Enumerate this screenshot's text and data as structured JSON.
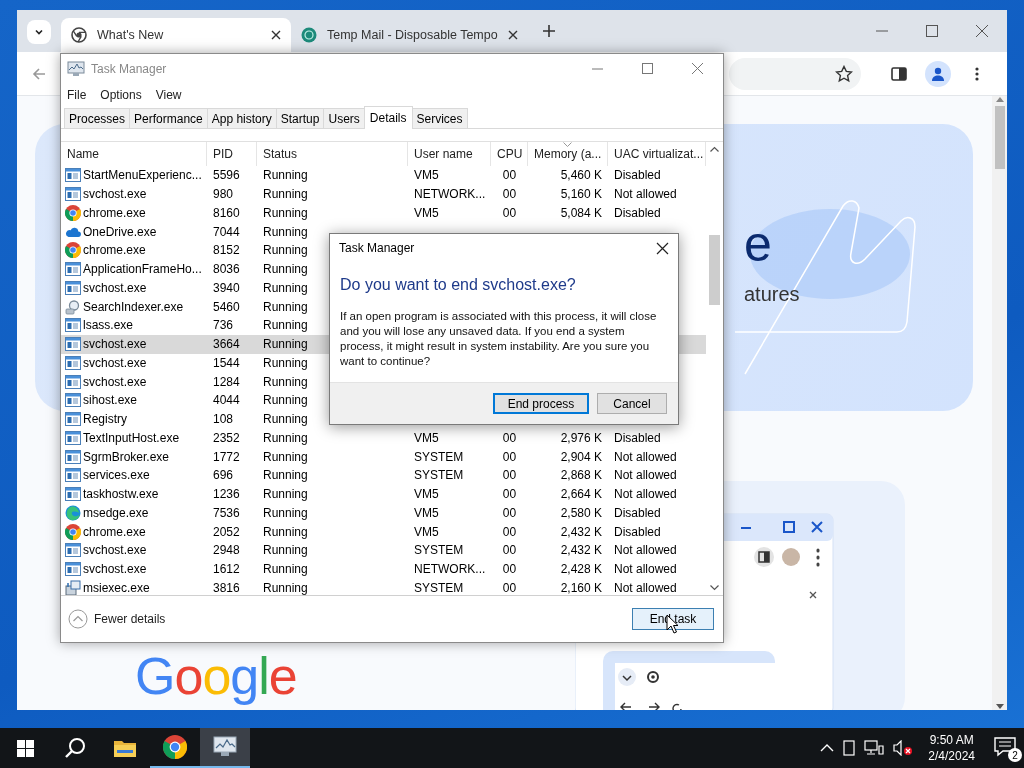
{
  "browser": {
    "tabs": [
      {
        "title": "What's New",
        "selected": true,
        "kind": "chrome"
      },
      {
        "title": "Temp Mail - Disposable Tempo",
        "selected": false,
        "kind": "mail"
      }
    ],
    "page": {
      "heading_fragment": "e",
      "subheading_fragment": "atures",
      "logo": "Google"
    }
  },
  "task_manager": {
    "title": "Task Manager",
    "menu": [
      "File",
      "Options",
      "View"
    ],
    "tabs": [
      {
        "label": "Processes",
        "selected": false
      },
      {
        "label": "Performance",
        "selected": false
      },
      {
        "label": "App history",
        "selected": false
      },
      {
        "label": "Startup",
        "selected": false
      },
      {
        "label": "Users",
        "selected": false
      },
      {
        "label": "Details",
        "selected": true
      },
      {
        "label": "Services",
        "selected": false
      }
    ],
    "columns": [
      "Name",
      "PID",
      "Status",
      "User name",
      "CPU",
      "Memory (a...",
      "UAC virtualizat..."
    ],
    "rows": [
      {
        "kind": "app",
        "name": "StartMenuExperienc...",
        "pid": "5596",
        "status": "Running",
        "user": "VM5",
        "cpu": "00",
        "memory": "5,460 K",
        "uac": "Disabled",
        "selected": false
      },
      {
        "kind": "app",
        "name": "svchost.exe",
        "pid": "980",
        "status": "Running",
        "user": "NETWORK...",
        "cpu": "00",
        "memory": "5,160 K",
        "uac": "Not allowed",
        "selected": false
      },
      {
        "kind": "chrome",
        "name": "chrome.exe",
        "pid": "8160",
        "status": "Running",
        "user": "VM5",
        "cpu": "00",
        "memory": "5,084 K",
        "uac": "Disabled",
        "selected": false
      },
      {
        "kind": "onedrive",
        "name": "OneDrive.exe",
        "pid": "7044",
        "status": "Running",
        "selected": false
      },
      {
        "kind": "chrome",
        "name": "chrome.exe",
        "pid": "8152",
        "status": "Running",
        "selected": false
      },
      {
        "kind": "app",
        "name": "ApplicationFrameHo...",
        "pid": "8036",
        "status": "Running",
        "selected": false
      },
      {
        "kind": "app",
        "name": "svchost.exe",
        "pid": "3940",
        "status": "Running",
        "selected": false
      },
      {
        "kind": "search",
        "name": "SearchIndexer.exe",
        "pid": "5460",
        "status": "Running",
        "selected": false
      },
      {
        "kind": "app",
        "name": "lsass.exe",
        "pid": "736",
        "status": "Running",
        "selected": false
      },
      {
        "kind": "app",
        "name": "svchost.exe",
        "pid": "3664",
        "status": "Running",
        "selected": true
      },
      {
        "kind": "app",
        "name": "svchost.exe",
        "pid": "1544",
        "status": "Running",
        "selected": false
      },
      {
        "kind": "app",
        "name": "svchost.exe",
        "pid": "1284",
        "status": "Running",
        "selected": false
      },
      {
        "kind": "app",
        "name": "sihost.exe",
        "pid": "4044",
        "status": "Running",
        "selected": false
      },
      {
        "kind": "app",
        "name": "Registry",
        "pid": "108",
        "status": "Running",
        "selected": false
      },
      {
        "kind": "app",
        "name": "TextInputHost.exe",
        "pid": "2352",
        "status": "Running",
        "user": "VM5",
        "cpu": "00",
        "memory": "2,976 K",
        "uac": "Disabled",
        "selected": false
      },
      {
        "kind": "app",
        "name": "SgrmBroker.exe",
        "pid": "1772",
        "status": "Running",
        "user": "SYSTEM",
        "cpu": "00",
        "memory": "2,904 K",
        "uac": "Not allowed",
        "selected": false
      },
      {
        "kind": "app",
        "name": "services.exe",
        "pid": "696",
        "status": "Running",
        "user": "SYSTEM",
        "cpu": "00",
        "memory": "2,868 K",
        "uac": "Not allowed",
        "selected": false
      },
      {
        "kind": "app",
        "name": "taskhostw.exe",
        "pid": "1236",
        "status": "Running",
        "user": "VM5",
        "cpu": "00",
        "memory": "2,664 K",
        "uac": "Not allowed",
        "selected": false
      },
      {
        "kind": "edge",
        "name": "msedge.exe",
        "pid": "7536",
        "status": "Running",
        "user": "VM5",
        "cpu": "00",
        "memory": "2,580 K",
        "uac": "Disabled",
        "selected": false
      },
      {
        "kind": "chrome",
        "name": "chrome.exe",
        "pid": "2052",
        "status": "Running",
        "user": "VM5",
        "cpu": "00",
        "memory": "2,432 K",
        "uac": "Disabled",
        "selected": false
      },
      {
        "kind": "app",
        "name": "svchost.exe",
        "pid": "2948",
        "status": "Running",
        "user": "SYSTEM",
        "cpu": "00",
        "memory": "2,432 K",
        "uac": "Not allowed",
        "selected": false
      },
      {
        "kind": "app",
        "name": "svchost.exe",
        "pid": "1612",
        "status": "Running",
        "user": "NETWORK...",
        "cpu": "00",
        "memory": "2,428 K",
        "uac": "Not allowed",
        "selected": false
      },
      {
        "kind": "installer",
        "name": "msiexec.exe",
        "pid": "3816",
        "status": "Running",
        "user": "SYSTEM",
        "cpu": "00",
        "memory": "2,160 K",
        "uac": "Not allowed",
        "selected": false
      }
    ],
    "footer": {
      "details_toggle": "Fewer details",
      "end_task": "End task"
    }
  },
  "dialog": {
    "title": "Task Manager",
    "heading": "Do you want to end svchost.exe?",
    "message": "If an open program is associated with this process, it will close and you will lose any unsaved data. If you end a system process, it might result in system instability. Are you sure you want to continue?",
    "buttons": [
      {
        "label": "End process",
        "kind": "default"
      },
      {
        "label": "Cancel",
        "kind": "normal"
      }
    ]
  },
  "taskbar": {
    "time": "9:50 AM",
    "date": "2/4/2024",
    "notification_count": "2"
  }
}
